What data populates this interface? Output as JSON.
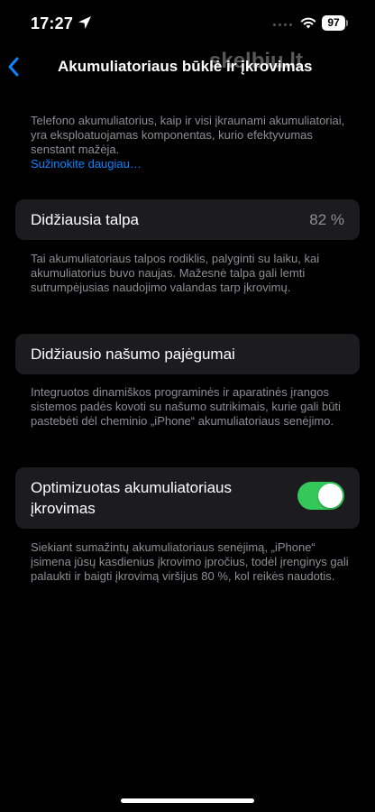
{
  "status_bar": {
    "time": "17:27",
    "battery_level": "97",
    "icons": [
      "location-arrow-icon",
      "wifi-icon",
      "battery-icon"
    ]
  },
  "nav": {
    "title": "Akumuliatoriaus būklė ir įkrovimas",
    "back_icon": "chevron-left-icon",
    "watermark": "skelbiu.lt"
  },
  "intro": {
    "text": "Telefono akumuliatorius, kaip ir visi įkraunami akumuliatoriai, yra eksploatuojamas komponentas, kurio efektyvumas senstant mažėja.",
    "link": "Sužinokite daugiau…"
  },
  "capacity": {
    "label": "Didžiausia talpa",
    "value": "82 %",
    "description": "Tai akumuliatoriaus talpos rodiklis, palyginti su laiku, kai akumuliatorius buvo naujas. Mažesnė talpa gali lemti sutrumpėjusias naudojimo valandas tarp įkrovimų."
  },
  "performance": {
    "label": "Didžiausio našumo pajėgumai",
    "description": "Integruotos dinamiškos programinės ir aparatinės įrangos sistemos padės kovoti su našumo sutrikimais, kurie gali būti pastebėti dėl cheminio „iPhone“ akumuliatoriaus senėjimo."
  },
  "optimized": {
    "label": "Optimizuotas akumuliatoriaus įkrovimas",
    "toggle_on": true,
    "toggle_color": "#34c759",
    "description": "Siekiant sumažintų akumuliatoriaus senėjimą, „iPhone“ įsimena jūsų kasdienius įkrovimo įpročius, todėl įrenginys gali palaukti ir baigti įkrovimą viršijus 80 %, kol reikės naudotis."
  },
  "colors": {
    "background": "#000000",
    "card": "#1c1c1e",
    "secondary_text": "#8e8e93",
    "link": "#0a84ff"
  }
}
